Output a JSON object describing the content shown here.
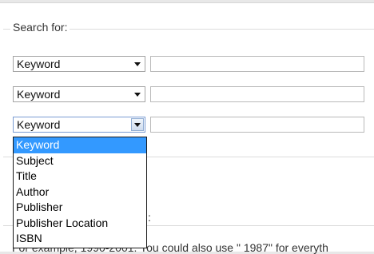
{
  "search": {
    "legend": "Search for:",
    "rows": [
      {
        "field": "Keyword",
        "value": ""
      },
      {
        "field": "Keyword",
        "value": ""
      },
      {
        "field": "Keyword",
        "value": ""
      }
    ]
  },
  "dropdown": {
    "open_row": 3,
    "selected": "Keyword",
    "options": [
      "Keyword",
      "Subject",
      "Title",
      "Author",
      "Publisher",
      "Publisher Location",
      "ISBN"
    ]
  },
  "section2": {
    "colon": ":"
  },
  "help_text": "For example, 1990-2001. You could also use \" 1987\" for everyth",
  "icons": {
    "select_arrow": "chevron-down-icon"
  }
}
